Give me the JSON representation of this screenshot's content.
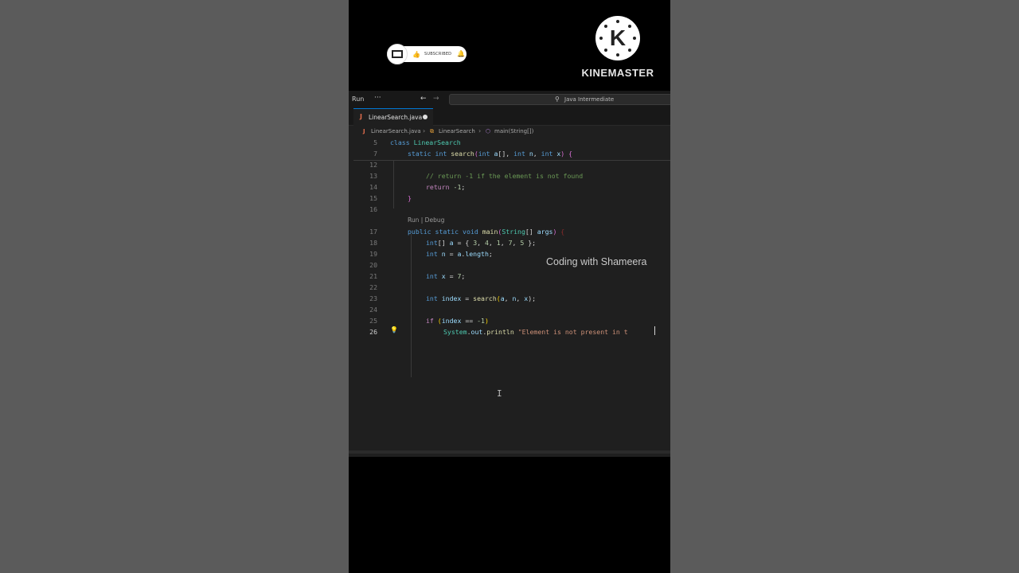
{
  "overlay": {
    "subscribe_text": "SUBSCRIBED",
    "brand_letter": "K",
    "brand_name": "KINEMASTER",
    "watermark": "Coding with Shameera"
  },
  "titlebar": {
    "run_label": "Run",
    "more_label": "···",
    "back_icon": "←",
    "forward_icon": "→",
    "search_text": "Java Intermediate"
  },
  "tab": {
    "icon": "J",
    "name": "LinearSearch.java"
  },
  "breadcrumb": {
    "file": "LinearSearch.java",
    "class": "LinearSearch",
    "method": "main(String[])"
  },
  "codelens": "Run | Debug",
  "line_numbers": [
    "5",
    "7",
    "12",
    "13",
    "14",
    "15",
    "16",
    "17",
    "18",
    "19",
    "20",
    "21",
    "22",
    "23",
    "24",
    "25",
    "26"
  ],
  "code": {
    "l5a": "class ",
    "l5b": "LinearSearch",
    "l7a": "static ",
    "l7b": "int ",
    "l7c": "search",
    "l7d": "(",
    "l7e": "int ",
    "l7f": "a",
    "l7g": "[], ",
    "l7h": "int ",
    "l7i": "n",
    "l7j": ", ",
    "l7k": "int ",
    "l7l": "x",
    "l7m": ") ",
    "l7n": "{",
    "l13": "// return -1 if the element is not found",
    "l14a": "return ",
    "l14b": "-1",
    "l14c": ";",
    "l15": "}",
    "l17a": "public ",
    "l17b": "static ",
    "l17c": "void ",
    "l17d": "main",
    "l17e": "(",
    "l17f": "String",
    "l17g": "[] ",
    "l17h": "args",
    "l17i": ") ",
    "l17j": "{",
    "l18a": "int",
    "l18b": "[] ",
    "l18c": "a",
    "l18d": " = { ",
    "l18e": "3",
    "l18f": ", ",
    "l18g": "4",
    "l18h": ", ",
    "l18i": "1",
    "l18j": ", ",
    "l18k": "7",
    "l18l": ", ",
    "l18m": "5",
    "l18n": " };",
    "l19a": "int ",
    "l19b": "n",
    "l19c": " = ",
    "l19d": "a",
    "l19e": ".",
    "l19f": "length",
    "l19g": ";",
    "l21a": "int ",
    "l21b": "x",
    "l21c": " = ",
    "l21d": "7",
    "l21e": ";",
    "l23a": "int ",
    "l23b": "index",
    "l23c": " = ",
    "l23d": "search",
    "l23e": "(",
    "l23f": "a",
    "l23g": ", ",
    "l23h": "n",
    "l23i": ", ",
    "l23j": "x",
    "l23k": ");",
    "l25a": "if ",
    "l25b": "(",
    "l25c": "index",
    "l25d": " == ",
    "l25e": "-1",
    "l25f": ")",
    "l26a": "System",
    "l26b": ".",
    "l26c": "out",
    "l26d": ".",
    "l26e": "println",
    "l26f": " ",
    "l26g": "\"Element is not present in t"
  }
}
